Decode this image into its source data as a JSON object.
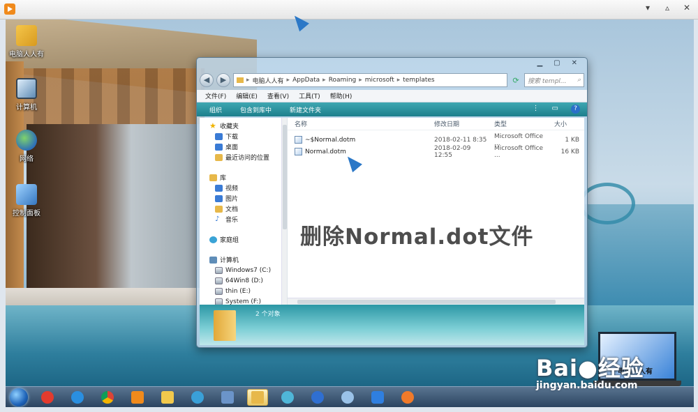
{
  "desktop_icons": [
    {
      "label": "电脑人人有",
      "icon": "user-folder-icon"
    },
    {
      "label": "计算机",
      "icon": "computer-icon"
    },
    {
      "label": "网络",
      "icon": "network-icon"
    },
    {
      "label": "控制面板",
      "icon": "control-panel-icon"
    }
  ],
  "explorer": {
    "breadcrumb": [
      "电脑人人有",
      "AppData",
      "Roaming",
      "microsoft",
      "templates"
    ],
    "search_placeholder": "搜索 templ...",
    "menu": [
      "文件(F)",
      "编辑(E)",
      "查看(V)",
      "工具(T)",
      "帮助(H)"
    ],
    "toolbar": {
      "organize": "组织",
      "include_library": "包含到库中",
      "new_folder": "新建文件夹"
    },
    "nav": {
      "favorites": "收藏夹",
      "favorites_items": [
        "下载",
        "桌面",
        "最近访问的位置"
      ],
      "library": "库",
      "library_items": [
        "视频",
        "图片",
        "文档",
        "音乐"
      ],
      "homegroup": "家庭组",
      "computer": "计算机",
      "computer_items": [
        "Windows7 (C:)",
        "64Win8  (D:)",
        "thin (E:)",
        "System (F:)"
      ]
    },
    "columns": {
      "name": "名称",
      "date": "修改日期",
      "type": "类型",
      "size": "大小"
    },
    "files": [
      {
        "name": "~$Normal.dotm",
        "date": "2018-02-11 8:35",
        "type": "Microsoft Office ...",
        "size": "1 KB"
      },
      {
        "name": "Normal.dotm",
        "date": "2018-02-09 12:55",
        "type": "Microsoft Office ...",
        "size": "16 KB"
      }
    ],
    "overlay_caption": "删除Normal.dot文件",
    "status": "2 个对象"
  },
  "watermark": {
    "brand": "Bai",
    "brand_rest": "经验",
    "url": "jingyan.baidu.com",
    "laptop_text": "电脑人人有"
  },
  "colors": {
    "toolbar": "#1d7f8c",
    "taskbar": "#2b4460",
    "cursor": "#2b78c7"
  }
}
